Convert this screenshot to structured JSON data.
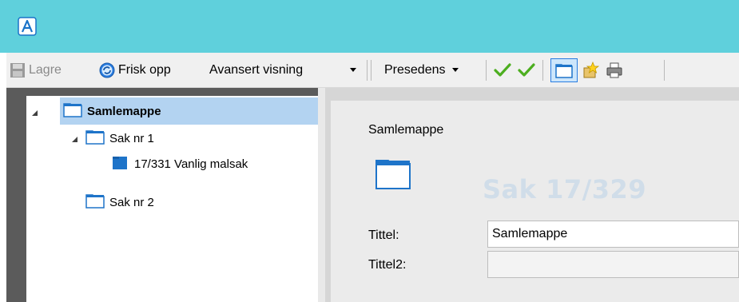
{
  "window": {
    "app_icon": "app-logo-letter-a"
  },
  "toolbar": {
    "save_label": "Lagre",
    "refresh_label": "Frisk opp",
    "view_mode_value": "Avansert visning",
    "precedent_label": "Presedens",
    "icons": [
      "save-icon",
      "refresh-icon",
      "dropdown-arrow-icon",
      "checkmark-icon",
      "checkmark-icon",
      "folder-view-icon",
      "new-star-icon",
      "print-icon"
    ]
  },
  "tree": {
    "items": [
      {
        "label": "Samlemappe",
        "level": 0,
        "expanded": true,
        "selected": true
      },
      {
        "label": "Sak nr 1",
        "level": 1,
        "expanded": true
      },
      {
        "label": "17/331 Vanlig malsak",
        "level": 2
      },
      {
        "label": "Sak nr 2",
        "level": 1
      }
    ]
  },
  "detail": {
    "header_label": "Samlemappe",
    "case_title": "Sak 17/329",
    "fields": [
      {
        "label": "Tittel:",
        "value": "Samlemappe"
      },
      {
        "label": "Tittel2:",
        "value": ""
      }
    ]
  },
  "colors": {
    "titlebar": "#5fd0dc",
    "selection": "#b3d3f1",
    "check_green": "#4cae1f",
    "folder_blue": "#1e74c9"
  }
}
